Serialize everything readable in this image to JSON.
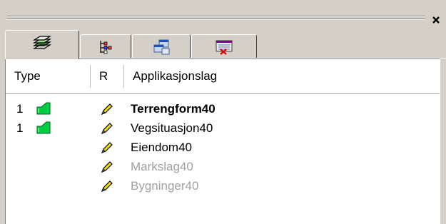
{
  "tabs": [
    {
      "icon": "layers-icon",
      "active": true
    },
    {
      "icon": "tree-hierarchy-icon",
      "active": false
    },
    {
      "icon": "windows-cascade-icon",
      "active": false
    },
    {
      "icon": "screen-close-icon",
      "active": false
    }
  ],
  "columns": {
    "type": "Type",
    "r": "R",
    "layer": "Applikasjonslag"
  },
  "rows": [
    {
      "type": "1",
      "has_layer_icon": true,
      "editable": true,
      "name": "Terrengform40",
      "style": "bold"
    },
    {
      "type": "1",
      "has_layer_icon": true,
      "editable": true,
      "name": "Vegsituasjon40",
      "style": "normal"
    },
    {
      "type": "",
      "has_layer_icon": false,
      "editable": true,
      "name": "Eiendom40",
      "style": "normal"
    },
    {
      "type": "",
      "has_layer_icon": false,
      "editable": true,
      "name": "Markslag40",
      "style": "grey"
    },
    {
      "type": "",
      "has_layer_icon": false,
      "editable": true,
      "name": "Bygninger40",
      "style": "grey"
    }
  ],
  "colors": {
    "panel": "#d4d0c8",
    "layer_green": "#00cc44",
    "pencil_yellow": "#f0e000",
    "disabled_text": "#a0a0a0"
  }
}
